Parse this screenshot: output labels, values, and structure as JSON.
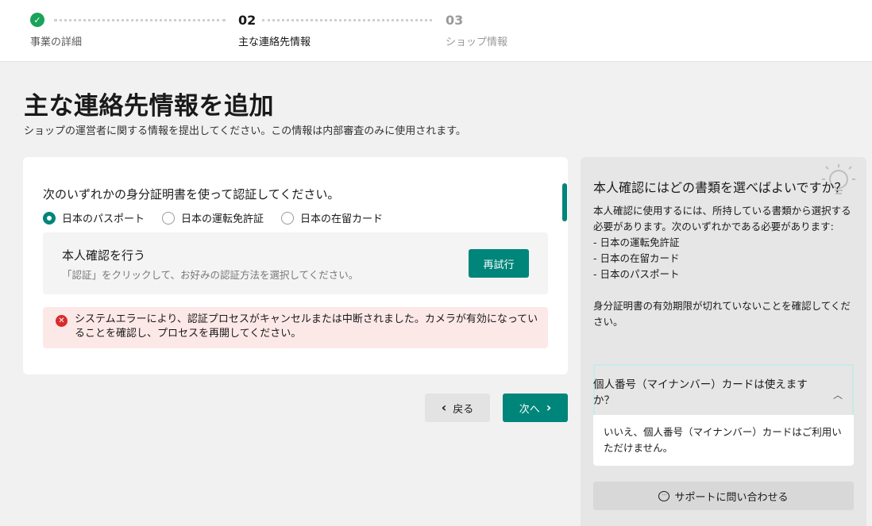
{
  "stepper": {
    "steps": [
      {
        "number": "",
        "label": "事業の詳細",
        "status": "complete"
      },
      {
        "number": "02",
        "label": "主な連絡先情報",
        "status": "current"
      },
      {
        "number": "03",
        "label": "ショップ情報",
        "status": "upcoming"
      }
    ]
  },
  "header": {
    "title": "主な連絡先情報を追加",
    "subtitle": "ショップの運営者に関する情報を提出してください。この情報は内部審査のみに使用されます。"
  },
  "form": {
    "question": "次のいずれかの身分証明書を使って認証してください。",
    "options": [
      {
        "label": "日本のパスポート",
        "selected": true
      },
      {
        "label": "日本の運転免許証",
        "selected": false
      },
      {
        "label": "日本の在留カード",
        "selected": false
      }
    ],
    "verify": {
      "title": "本人確認を行う",
      "hint": "「認証」をクリックして、お好みの認証方法を選択してください。",
      "retry_label": "再試行"
    },
    "error": "システムエラーにより、認証プロセスがキャンセルまたは中断されました。カメラが有効になっていることを確認し、プロセスを再開してください。"
  },
  "nav": {
    "back_label": "戻る",
    "next_label": "次へ"
  },
  "help": {
    "title": "本人確認にはどの書類を選べばよいですか？",
    "body": "本人確認に使用するには、所持している書類から選択する必要があります。次のいずれかである必要があります:\n- 日本の運転免許証\n- 日本の在留カード\n- 日本のパスポート\n\n身分証明書の有効期限が切れていないことを確認してください。",
    "faq_question": "個人番号（マイナンバー）カードは使えますか？",
    "faq_answer": "いいえ、個人番号（マイナンバー）カードはご利用いただけません。",
    "support_label": "サポートに問い合わせる"
  },
  "colors": {
    "accent": "#00857a",
    "success": "#1aa35a",
    "error": "#d82c2c",
    "error_bg": "#fde8e8"
  }
}
